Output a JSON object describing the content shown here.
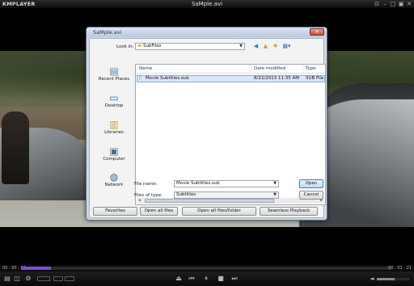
{
  "window": {
    "logo": "KMPLAYER",
    "title": "SaMple.avi"
  },
  "dialog": {
    "title": "SaMple.avi",
    "look_in_label": "Look in:",
    "look_in_value": "SubFiles",
    "places": [
      {
        "label": "Recent Places",
        "icon": "recent-places-icon"
      },
      {
        "label": "Desktop",
        "icon": "desktop-icon"
      },
      {
        "label": "Libraries",
        "icon": "libraries-icon"
      },
      {
        "label": "Computer",
        "icon": "computer-icon"
      },
      {
        "label": "Network",
        "icon": "network-icon"
      }
    ],
    "columns": {
      "name": "Name",
      "date": "Date modified",
      "type": "Type"
    },
    "files": [
      {
        "name": "Movie Subtitles.sub",
        "date": "8/22/2013 11:35 AM",
        "type": "SUB File"
      }
    ],
    "filename_label": "File name:",
    "filename_value": "Movie Subtitles.sub",
    "filetype_label": "Files of type:",
    "filetype_value": "Subtitles",
    "open_button": "Open",
    "cancel_button": "Cancel",
    "bottom_buttons": {
      "favorites": "Favorites",
      "open_all": "Open all files",
      "open_all_folder": "Open all files/folder",
      "seamless": "Seamless Playback"
    }
  },
  "player": {
    "time_elapsed": "00 : 00 : 06",
    "time_total": "00 : 01 : 21",
    "progress_fraction": 0.08,
    "volume_fraction": 0.55,
    "accent_color": "#7a4fd0"
  }
}
